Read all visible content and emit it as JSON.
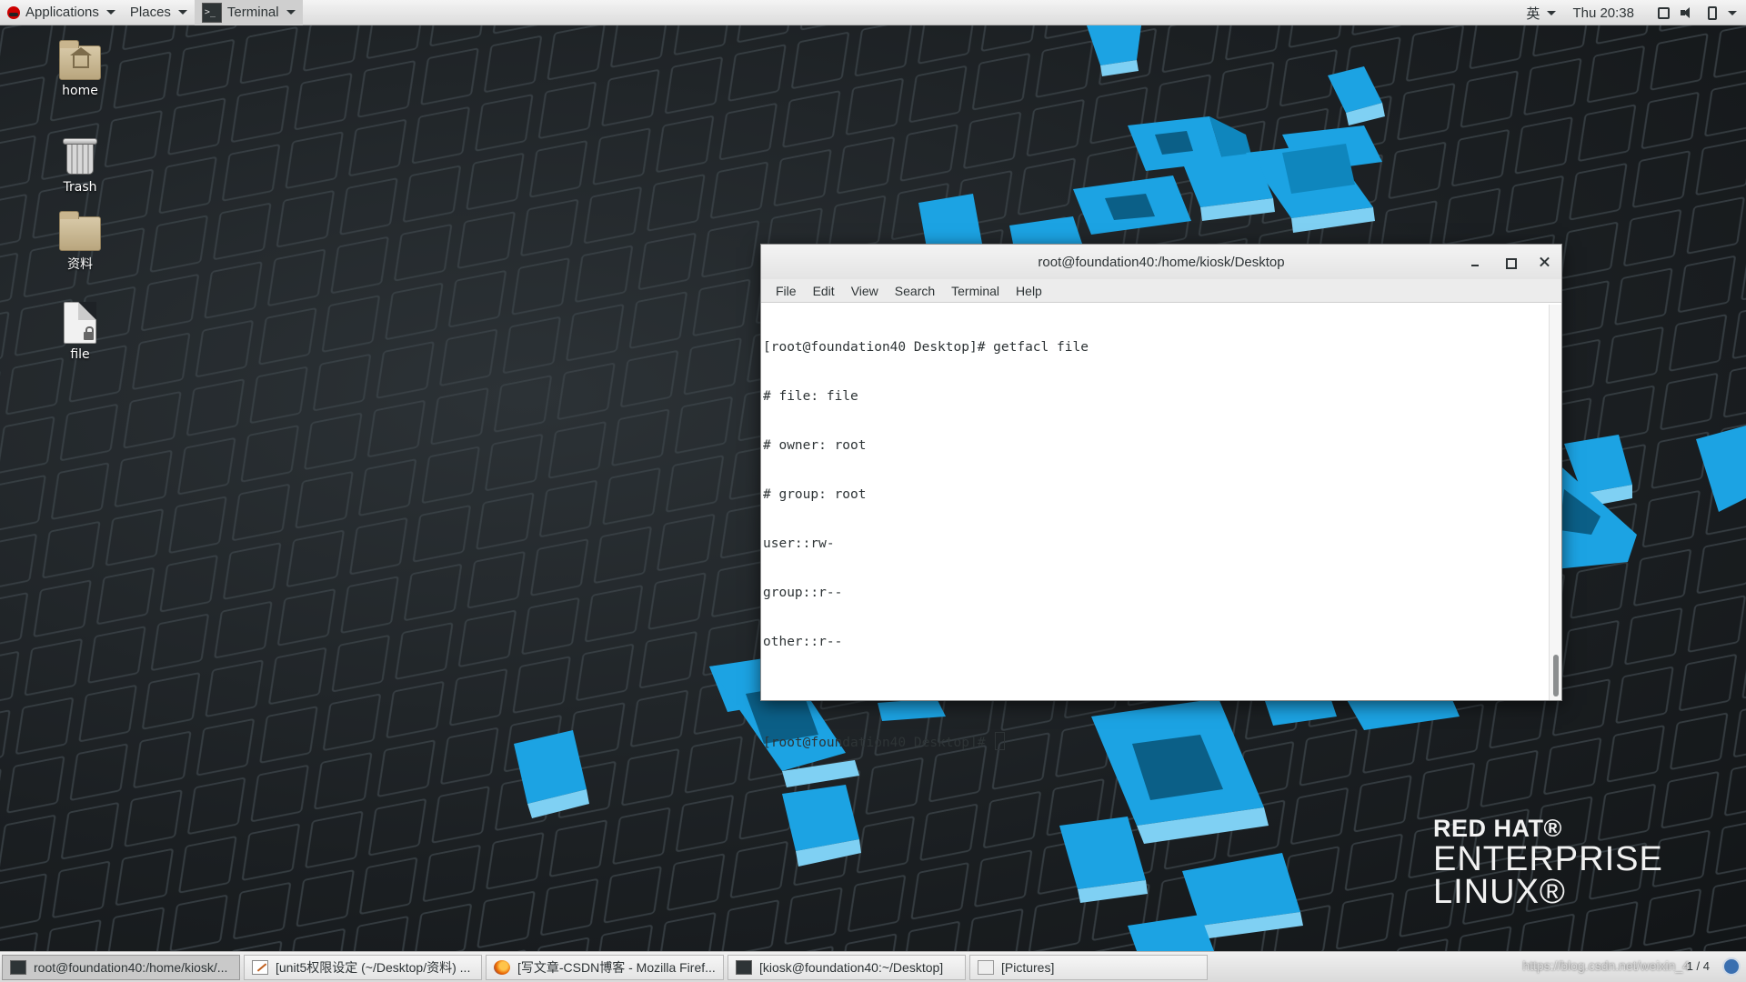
{
  "topbar": {
    "applications_label": "Applications",
    "places_label": "Places",
    "active_app_label": "Terminal",
    "input_method": "英",
    "clock": "Thu 20:38"
  },
  "desktop_icons": {
    "home": "home",
    "trash": "Trash",
    "folder_ziliao": "资料",
    "file": "file"
  },
  "terminal": {
    "title": "root@foundation40:/home/kiosk/Desktop",
    "menu": [
      "File",
      "Edit",
      "View",
      "Search",
      "Terminal",
      "Help"
    ],
    "lines": [
      "[root@foundation40 Desktop]# getfacl file",
      "# file: file",
      "# owner: root",
      "# group: root",
      "user::rw-",
      "group::r--",
      "other::r--",
      ""
    ],
    "prompt": "[root@foundation40 Desktop]# "
  },
  "logo": {
    "line1": "RED HAT®",
    "line2": "ENTERPRISE",
    "line3": "LINUX®"
  },
  "taskbar": {
    "tasks": [
      "root@foundation40:/home/kiosk/...",
      "[unit5权限设定 (~/Desktop/资料) ...",
      "[写文章-CSDN博客 - Mozilla Firef...",
      "[kiosk@foundation40:~/Desktop]",
      "[Pictures]"
    ],
    "watermark": "https://blog.csdn.net/weixin_4",
    "pager": "1 / 4"
  },
  "colors": {
    "cube_blue": "#1ca3e3",
    "cube_light": "#7fd0f3",
    "terminal_bg": "#ffffff"
  }
}
